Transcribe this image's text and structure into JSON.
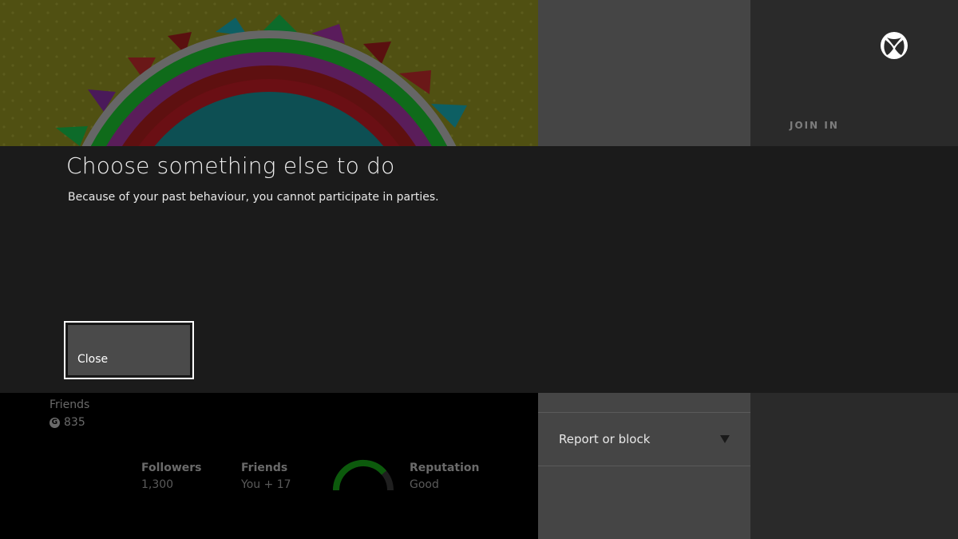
{
  "dialog": {
    "title": "Choose something else to do",
    "message": "Because of your past behaviour, you cannot participate in parties.",
    "close_label": "Close"
  },
  "header": {
    "join_in": "JOIN IN"
  },
  "profile": {
    "friends_label": "Friends",
    "gamerscore": "835",
    "gamerscore_badge": "G",
    "stats": {
      "followers_label": "Followers",
      "followers_value": "1,300",
      "friends_label": "Friends",
      "friends_value": "You + 17",
      "reputation_label": "Reputation",
      "reputation_value": "Good"
    }
  },
  "menu": {
    "report_label": "Report or block"
  },
  "colors": {
    "dialog_bg": "#1b1b1b",
    "accent_green": "#107c10",
    "mid_panel": "#454545"
  }
}
